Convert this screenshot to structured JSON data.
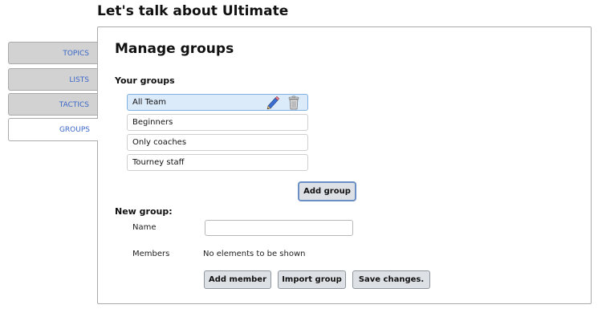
{
  "app": {
    "title": "Let's talk about Ultimate"
  },
  "tabs": [
    {
      "label": "TOPICS",
      "active": false
    },
    {
      "label": "LISTS",
      "active": false
    },
    {
      "label": "TACTICS",
      "active": false
    },
    {
      "label": "GROUPS",
      "active": true
    }
  ],
  "panel": {
    "title": "Manage groups",
    "your_groups_label": "Your groups",
    "groups": [
      {
        "name": "All Team",
        "selected": true
      },
      {
        "name": "Beginners",
        "selected": false
      },
      {
        "name": "Only coaches",
        "selected": false
      },
      {
        "name": "Tourney staff",
        "selected": false
      }
    ],
    "row_icons": [
      "pencil-icon",
      "trash-icon"
    ],
    "add_group_label": "Add group",
    "new_group_label": "New group:",
    "name_label": "Name",
    "name_value": "",
    "members_label": "Members",
    "members_empty": "No elements to be shown",
    "add_member_label": "Add member",
    "import_group_label": "Import group",
    "save_changes_label": "Save changes."
  },
  "colors": {
    "tab_text": "#3a67c9",
    "selected_row": "#dcebfa",
    "button_bg": "#dde1e6"
  }
}
